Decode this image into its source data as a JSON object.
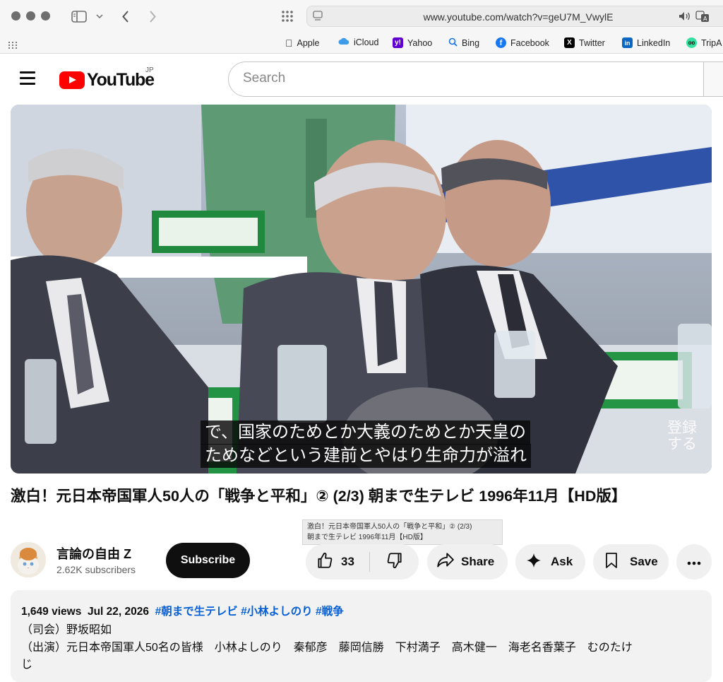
{
  "browser": {
    "url": "www.youtube.com/watch?v=geU7M_VwylE",
    "bookmarks": [
      "Apple",
      "iCloud",
      "Yahoo",
      "Bing",
      "Facebook",
      "Twitter",
      "LinkedIn",
      "TripA"
    ]
  },
  "header": {
    "logo_text": "YouTube",
    "region": "JP",
    "search_placeholder": "Search"
  },
  "player": {
    "caption_line1": "で、国家のためとか大義のためとか天皇の",
    "caption_line2": "ためなどという建前とやはり生命力が溢れ",
    "watermark_line1": "登録",
    "watermark_line2": "する"
  },
  "video": {
    "title": "激白！元日本帝国軍人50人の「戦争と平和」② (2/3) 朝まで生テレビ 1996年11月【HD版】",
    "tooltip_line1": "激白！元日本帝国軍人50人の「戦争と平和」② (2/3)",
    "tooltip_line2": "朝まで生テレビ 1996年11月【HD版】"
  },
  "channel": {
    "name": "言論の自由 Z",
    "subscribers": "2.62K subscribers",
    "subscribe_label": "Subscribe"
  },
  "actions": {
    "like_count": "33",
    "share_label": "Share",
    "ask_label": "Ask",
    "save_label": "Save"
  },
  "description": {
    "views": "1,649 views",
    "date": "Jul 22, 2026",
    "hashtags": [
      "#朝まで生テレビ",
      "#小林よしのり",
      "#戦争"
    ],
    "line1": "（司会）野坂昭如",
    "line2": "（出演）元日本帝国軍人50名の皆様　小林よしのり　秦郁彦　藤岡信勝　下村満子　高木健一　海老名香葉子　むのたけ",
    "line3": "じ"
  },
  "colors": {
    "yt_red": "#ff0000",
    "link_blue": "#065fd4",
    "subscribe_bg": "#0f0f0f",
    "pill_bg": "#f0f0f0"
  }
}
